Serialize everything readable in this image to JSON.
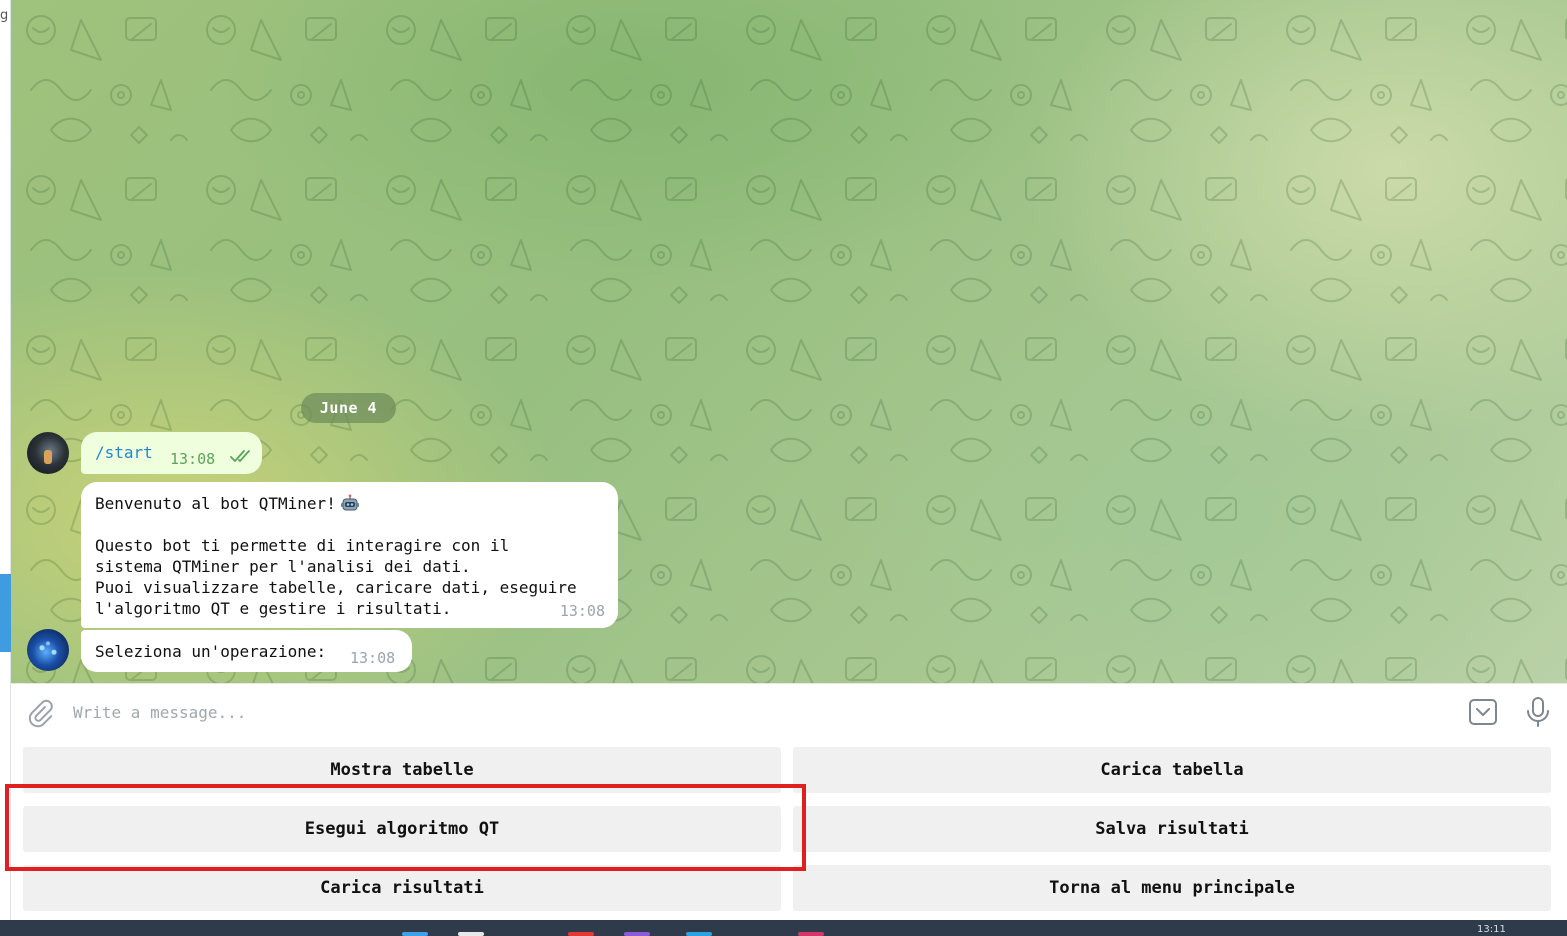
{
  "left_pane": {
    "cut_text": "g"
  },
  "chat": {
    "date_label": "June 4",
    "messages": [
      {
        "from": "user",
        "text": "/start",
        "time": "13:08",
        "status": "read"
      },
      {
        "from": "bot",
        "lines": [
          "Benvenuto al bot QTMiner!",
          "",
          "Questo bot ti permette di interagire con il",
          "sistema QTMiner per l'analisi dei dati.",
          "Puoi visualizzare tabelle, caricare dati, eseguire",
          "l'algoritmo QT e gestire i risultati."
        ],
        "emoji": "robot-face-icon",
        "time": "13:08"
      },
      {
        "from": "bot",
        "text": "Seleziona un'operazione:",
        "time": "13:08"
      }
    ]
  },
  "composer": {
    "placeholder": "Write a message..."
  },
  "keyboard": {
    "buttons": [
      [
        "Mostra tabelle",
        "Carica tabella"
      ],
      [
        "Esegui algoritmo QT",
        "Salva risultati"
      ],
      [
        "Carica risultati",
        "Torna al menu principale"
      ]
    ],
    "highlighted_button": "Esegui algoritmo QT",
    "highlight_color": "#e02020"
  },
  "taskbar": {
    "clock": "13:11"
  },
  "colors": {
    "outgoing_bubble": "#effedd",
    "incoming_bubble": "#ffffff",
    "link": "#1f8ad0",
    "read_ticks": "#5aa45c",
    "button_bg": "#f0f0f0"
  }
}
